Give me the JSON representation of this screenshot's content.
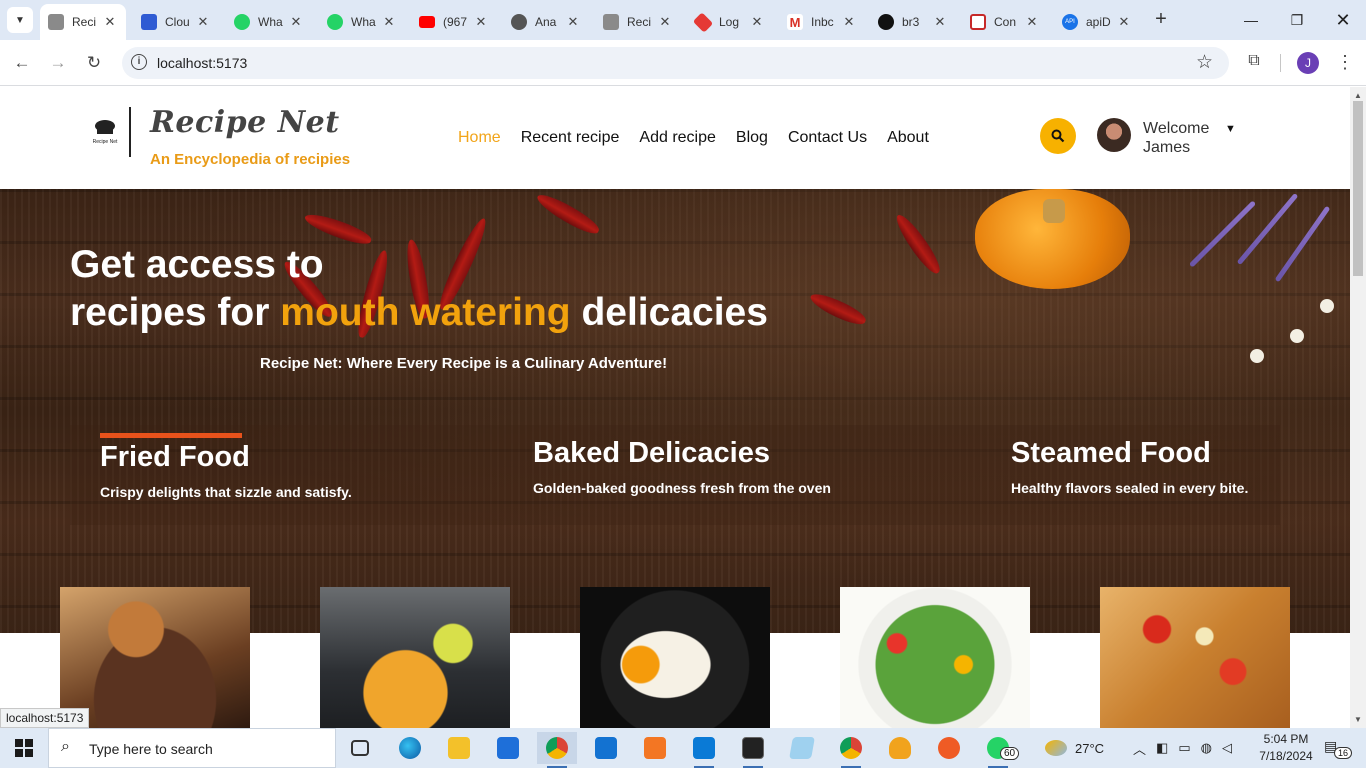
{
  "browser": {
    "tabs": [
      {
        "label": "Reci",
        "color": "#8a8a8a",
        "glyph": "",
        "active": true
      },
      {
        "label": "Clou",
        "color": "#2f5bd3",
        "glyph": "",
        "active": false
      },
      {
        "label": "Wha",
        "color": "#25d366",
        "glyph": "",
        "active": false
      },
      {
        "label": "Wha",
        "color": "#25d366",
        "glyph": "",
        "active": false
      },
      {
        "label": "(967",
        "color": "#ff0000",
        "glyph": "",
        "active": false
      },
      {
        "label": "Ana",
        "color": "#555555",
        "glyph": "",
        "active": false
      },
      {
        "label": "Reci",
        "color": "#8a8a8a",
        "glyph": "",
        "active": false
      },
      {
        "label": "Log",
        "color": "#e53935",
        "glyph": "",
        "active": false
      },
      {
        "label": "Inbc",
        "color": "#d93025",
        "glyph": "M",
        "active": false
      },
      {
        "label": "br3",
        "color": "#111111",
        "glyph": "",
        "active": false
      },
      {
        "label": "Con",
        "color": "#c62828",
        "glyph": "",
        "active": false
      },
      {
        "label": "apiD",
        "color": "#1a73e8",
        "glyph": "API",
        "active": false
      }
    ],
    "url": "localhost:5173",
    "profile_initial": "J",
    "status_url": "localhost:5173"
  },
  "site": {
    "brand_name": "Recipe Net",
    "brand_tagline": "An Encyclopedia of recipies",
    "logo_text": "Recipe Net",
    "nav": [
      {
        "label": "Home",
        "active": true
      },
      {
        "label": "Recent recipe",
        "active": false
      },
      {
        "label": "Add recipe",
        "active": false
      },
      {
        "label": "Blog",
        "active": false
      },
      {
        "label": "Contact Us",
        "active": false
      },
      {
        "label": "About",
        "active": false
      }
    ],
    "welcome_line1": "Welcome",
    "welcome_line2": "James"
  },
  "hero": {
    "title_line1": "Get access to",
    "title_line2_pre": "recipes for ",
    "title_line2_accent": "mouth watering",
    "title_line2_post": " delicacies",
    "subtitle": "Recipe Net: Where Every Recipe is a Culinary Adventure!",
    "categories": [
      {
        "title": "Fried Food",
        "desc": "Crispy delights that sizzle and satisfy.",
        "selected": true
      },
      {
        "title": "Baked Delicacies",
        "desc": "Golden-baked goodness fresh from the oven",
        "selected": false
      },
      {
        "title": "Steamed Food",
        "desc": "Healthy flavors sealed in every bite.",
        "selected": false
      }
    ]
  },
  "taskbar": {
    "search_placeholder": "Type here to search",
    "weather_temp": "27°C",
    "time": "5:04 PM",
    "date": "7/18/2024",
    "whatsapp_badge": "60",
    "notifications_count": "16"
  },
  "colors": {
    "accent_orange": "#f2a20d",
    "nav_active": "#f2a51a",
    "category_bar": "#e8521b",
    "search_button": "#f7b100"
  }
}
